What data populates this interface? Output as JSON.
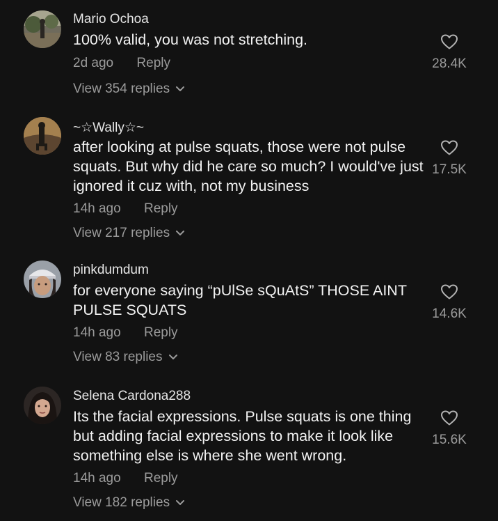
{
  "comments": [
    {
      "username": "Mario Ochoa",
      "text": "100% valid, you was not stretching.",
      "time": "2d ago",
      "reply_label": "Reply",
      "view_replies": "View 354 replies",
      "likes": "28.4K",
      "avatar_icon": "avatar-outdoor-photo"
    },
    {
      "username": "~☆Wally☆~",
      "text": "after looking at pulse squats, those were not pulse squats. But why did he care so much? I would've just ignored it cuz with, not my business",
      "time": "14h ago",
      "reply_label": "Reply",
      "view_replies": "View 217 replies",
      "likes": "17.5K",
      "avatar_icon": "avatar-silhouette-photo"
    },
    {
      "username": "pinkdumdum",
      "text": "for everyone saying “pUlSe sQuAtS” THOSE AINT PULSE SQUATS",
      "time": "14h ago",
      "reply_label": "Reply",
      "view_replies": "View 83 replies",
      "likes": "14.6K",
      "avatar_icon": "avatar-girl-cap-photo"
    },
    {
      "username": "Selena Cardona288",
      "text": "Its the facial expressions. Pulse squats is one thing but adding facial expressions to make it look like something else is where she went wrong.",
      "time": "14h ago",
      "reply_label": "Reply",
      "view_replies": "View 182 replies",
      "likes": "15.6K",
      "avatar_icon": "avatar-woman-photo"
    }
  ],
  "colors": {
    "background": "#121212",
    "primary_text": "#f2f2f2",
    "secondary_text": "#9b9b9b"
  },
  "icons": {
    "like": "heart-outline-icon",
    "expand": "chevron-down-icon"
  }
}
